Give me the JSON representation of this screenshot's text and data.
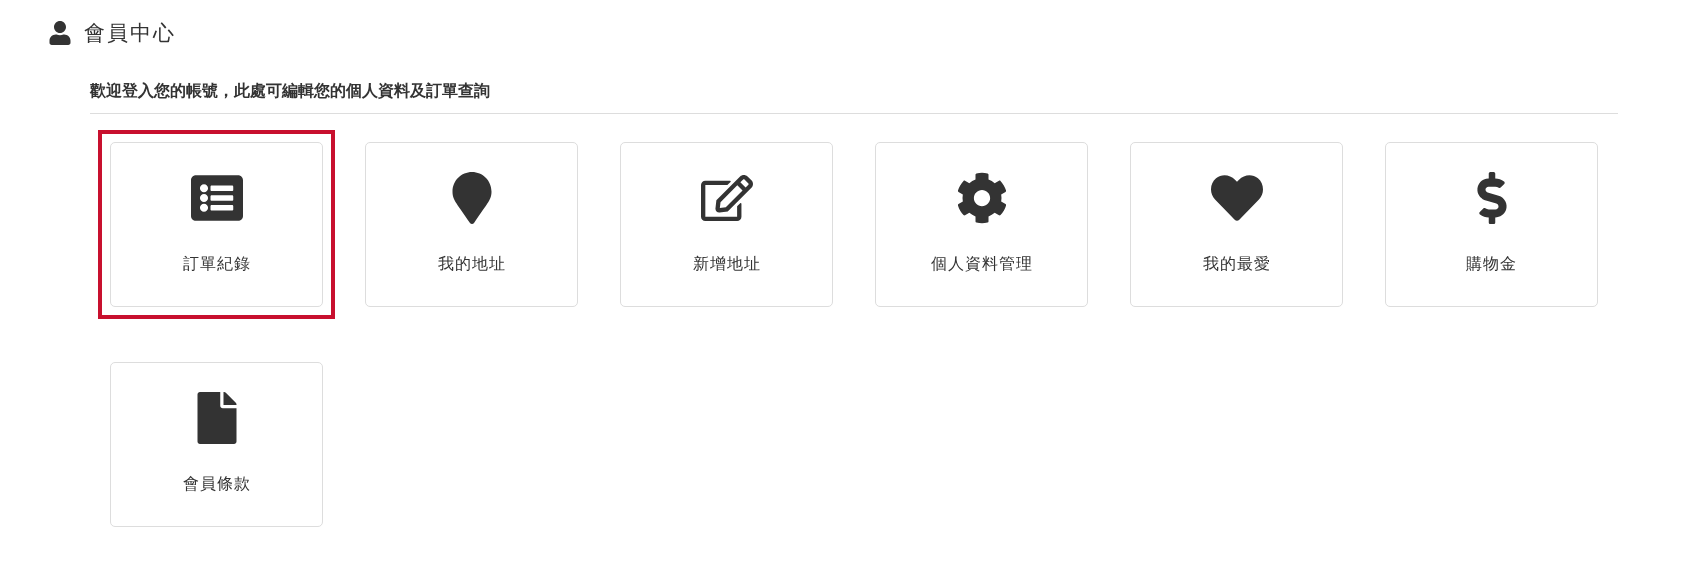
{
  "page_title": "會員中心",
  "welcome": "歡迎登入您的帳號，此處可編輯您的個人資料及訂單查詢",
  "tiles": [
    {
      "kind": "orders",
      "label": "訂單紀錄",
      "selected": true
    },
    {
      "kind": "address",
      "label": "我的地址",
      "selected": false
    },
    {
      "kind": "add-address",
      "label": "新增地址",
      "selected": false
    },
    {
      "kind": "profile",
      "label": "個人資料管理",
      "selected": false
    },
    {
      "kind": "favorites",
      "label": "我的最愛",
      "selected": false
    },
    {
      "kind": "credit",
      "label": "購物金",
      "selected": false
    },
    {
      "kind": "terms",
      "label": "會員條款",
      "selected": false
    }
  ]
}
